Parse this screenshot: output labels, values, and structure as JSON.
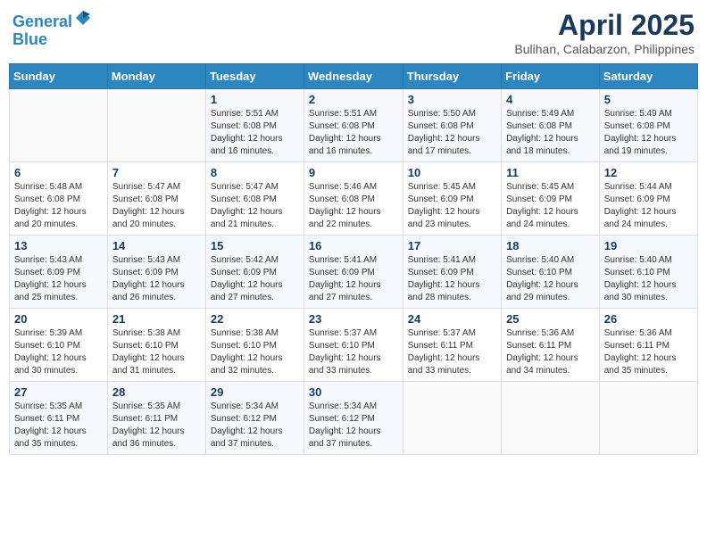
{
  "header": {
    "logo_line1": "General",
    "logo_line2": "Blue",
    "title": "April 2025",
    "subtitle": "Bulihan, Calabarzon, Philippines"
  },
  "weekdays": [
    "Sunday",
    "Monday",
    "Tuesday",
    "Wednesday",
    "Thursday",
    "Friday",
    "Saturday"
  ],
  "weeks": [
    [
      {
        "day": "",
        "info": ""
      },
      {
        "day": "",
        "info": ""
      },
      {
        "day": "1",
        "info": "Sunrise: 5:51 AM\nSunset: 6:08 PM\nDaylight: 12 hours and 16 minutes."
      },
      {
        "day": "2",
        "info": "Sunrise: 5:51 AM\nSunset: 6:08 PM\nDaylight: 12 hours and 16 minutes."
      },
      {
        "day": "3",
        "info": "Sunrise: 5:50 AM\nSunset: 6:08 PM\nDaylight: 12 hours and 17 minutes."
      },
      {
        "day": "4",
        "info": "Sunrise: 5:49 AM\nSunset: 6:08 PM\nDaylight: 12 hours and 18 minutes."
      },
      {
        "day": "5",
        "info": "Sunrise: 5:49 AM\nSunset: 6:08 PM\nDaylight: 12 hours and 19 minutes."
      }
    ],
    [
      {
        "day": "6",
        "info": "Sunrise: 5:48 AM\nSunset: 6:08 PM\nDaylight: 12 hours and 20 minutes."
      },
      {
        "day": "7",
        "info": "Sunrise: 5:47 AM\nSunset: 6:08 PM\nDaylight: 12 hours and 20 minutes."
      },
      {
        "day": "8",
        "info": "Sunrise: 5:47 AM\nSunset: 6:08 PM\nDaylight: 12 hours and 21 minutes."
      },
      {
        "day": "9",
        "info": "Sunrise: 5:46 AM\nSunset: 6:08 PM\nDaylight: 12 hours and 22 minutes."
      },
      {
        "day": "10",
        "info": "Sunrise: 5:45 AM\nSunset: 6:09 PM\nDaylight: 12 hours and 23 minutes."
      },
      {
        "day": "11",
        "info": "Sunrise: 5:45 AM\nSunset: 6:09 PM\nDaylight: 12 hours and 24 minutes."
      },
      {
        "day": "12",
        "info": "Sunrise: 5:44 AM\nSunset: 6:09 PM\nDaylight: 12 hours and 24 minutes."
      }
    ],
    [
      {
        "day": "13",
        "info": "Sunrise: 5:43 AM\nSunset: 6:09 PM\nDaylight: 12 hours and 25 minutes."
      },
      {
        "day": "14",
        "info": "Sunrise: 5:43 AM\nSunset: 6:09 PM\nDaylight: 12 hours and 26 minutes."
      },
      {
        "day": "15",
        "info": "Sunrise: 5:42 AM\nSunset: 6:09 PM\nDaylight: 12 hours and 27 minutes."
      },
      {
        "day": "16",
        "info": "Sunrise: 5:41 AM\nSunset: 6:09 PM\nDaylight: 12 hours and 27 minutes."
      },
      {
        "day": "17",
        "info": "Sunrise: 5:41 AM\nSunset: 6:09 PM\nDaylight: 12 hours and 28 minutes."
      },
      {
        "day": "18",
        "info": "Sunrise: 5:40 AM\nSunset: 6:10 PM\nDaylight: 12 hours and 29 minutes."
      },
      {
        "day": "19",
        "info": "Sunrise: 5:40 AM\nSunset: 6:10 PM\nDaylight: 12 hours and 30 minutes."
      }
    ],
    [
      {
        "day": "20",
        "info": "Sunrise: 5:39 AM\nSunset: 6:10 PM\nDaylight: 12 hours and 30 minutes."
      },
      {
        "day": "21",
        "info": "Sunrise: 5:38 AM\nSunset: 6:10 PM\nDaylight: 12 hours and 31 minutes."
      },
      {
        "day": "22",
        "info": "Sunrise: 5:38 AM\nSunset: 6:10 PM\nDaylight: 12 hours and 32 minutes."
      },
      {
        "day": "23",
        "info": "Sunrise: 5:37 AM\nSunset: 6:10 PM\nDaylight: 12 hours and 33 minutes."
      },
      {
        "day": "24",
        "info": "Sunrise: 5:37 AM\nSunset: 6:11 PM\nDaylight: 12 hours and 33 minutes."
      },
      {
        "day": "25",
        "info": "Sunrise: 5:36 AM\nSunset: 6:11 PM\nDaylight: 12 hours and 34 minutes."
      },
      {
        "day": "26",
        "info": "Sunrise: 5:36 AM\nSunset: 6:11 PM\nDaylight: 12 hours and 35 minutes."
      }
    ],
    [
      {
        "day": "27",
        "info": "Sunrise: 5:35 AM\nSunset: 6:11 PM\nDaylight: 12 hours and 35 minutes."
      },
      {
        "day": "28",
        "info": "Sunrise: 5:35 AM\nSunset: 6:11 PM\nDaylight: 12 hours and 36 minutes."
      },
      {
        "day": "29",
        "info": "Sunrise: 5:34 AM\nSunset: 6:12 PM\nDaylight: 12 hours and 37 minutes."
      },
      {
        "day": "30",
        "info": "Sunrise: 5:34 AM\nSunset: 6:12 PM\nDaylight: 12 hours and 37 minutes."
      },
      {
        "day": "",
        "info": ""
      },
      {
        "day": "",
        "info": ""
      },
      {
        "day": "",
        "info": ""
      }
    ]
  ]
}
